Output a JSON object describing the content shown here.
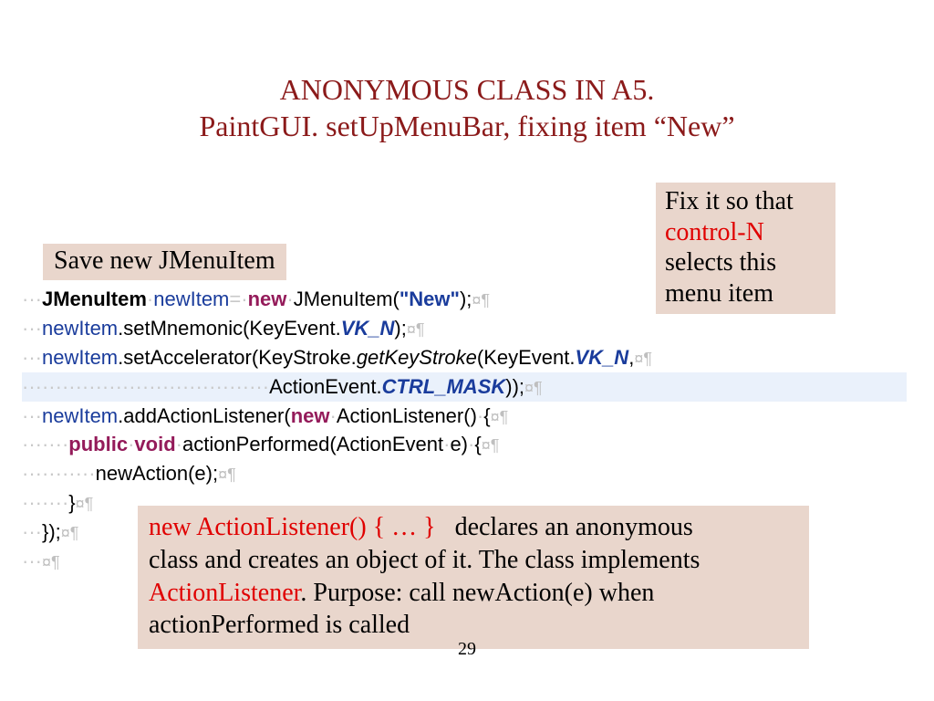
{
  "title": {
    "line1": "ANONYMOUS CLASS IN A5.",
    "line2": "PaintGUI. setUpMenuBar, fixing item “New”"
  },
  "save_label": "Save new JMenuItem",
  "fix": {
    "l1": "Fix it so that",
    "red": "control-N",
    "l3": "selects this",
    "l4": "menu item"
  },
  "code": {
    "l1": {
      "ws": "···",
      "t1": "JMenuItem",
      "sp1": "·",
      "f": "newItem",
      "eq": "=·",
      "kw": "new",
      "sp2": "·",
      "t2": "JMenuItem(",
      "s": "\"New\"",
      "end": ");"
    },
    "l2": {
      "ws": "···",
      "f": "newItem",
      "m": ".setMnemonic(KeyEvent.",
      "c": "VK_N",
      "end": ");"
    },
    "l3": {
      "ws": "···",
      "f": "newItem",
      "m1": ".setAccelerator(KeyStroke.",
      "sm": "getKeyStroke",
      "m2": "(KeyEvent.",
      "c": "VK_N",
      "end": ","
    },
    "l4": {
      "ws": "·····································",
      "t": "ActionEvent.",
      "c": "CTRL_MASK",
      "end": "));"
    },
    "l5": {
      "ws": "···",
      "f": "newItem",
      "m": ".addActionListener(",
      "kw": "new",
      "sp": "·",
      "t": "ActionListener()",
      "sp2": "·",
      "br": "{"
    },
    "l6": {
      "ws": "·······",
      "kw": "public",
      "sp1": "·",
      "kw2": "void",
      "sp2": "·",
      "m": "actionPerformed(ActionEvent",
      "sp3": "·",
      "p": "e)",
      "sp4": "·",
      "br": "{"
    },
    "l7": {
      "ws": "···········",
      "m": "newAction(e);"
    },
    "l8": {
      "ws": "·······",
      "br": "}"
    },
    "l9": {
      "ws": "···",
      "br": "});"
    },
    "l10": {
      "ws": "···"
    }
  },
  "explain": {
    "r1": "new ActionListener() { … }",
    "t1": "   declares an anonymous",
    "t2": "class and creates an object of it. The class implements",
    "r2": "ActionListener",
    "t3": ". Purpose: call newAction(e) when",
    "t4": "actionPerformed is called"
  },
  "page": "29",
  "eol": "¤¶"
}
